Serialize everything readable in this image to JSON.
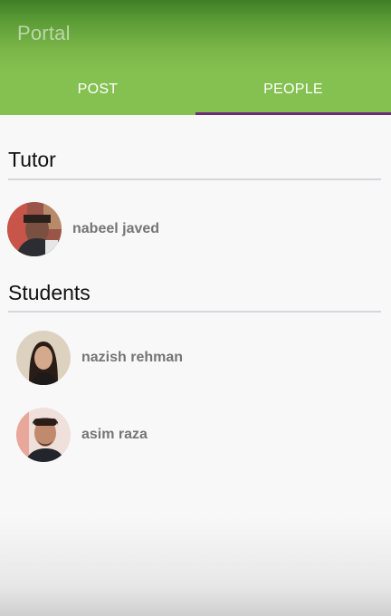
{
  "app": {
    "title": "Portal"
  },
  "tabs": [
    {
      "label": "POST",
      "selected": false
    },
    {
      "label": "PEOPLE",
      "selected": true
    }
  ],
  "colors": {
    "app_bar": "#84c151",
    "tab_indicator": "#6b2d7a",
    "name_text": "#757575"
  },
  "tutor_section": {
    "title": "Tutor",
    "people": [
      {
        "name": "nabeel javed"
      }
    ]
  },
  "students_section": {
    "title": "Students",
    "people": [
      {
        "name": "nazish rehman"
      },
      {
        "name": "asim raza"
      }
    ]
  }
}
